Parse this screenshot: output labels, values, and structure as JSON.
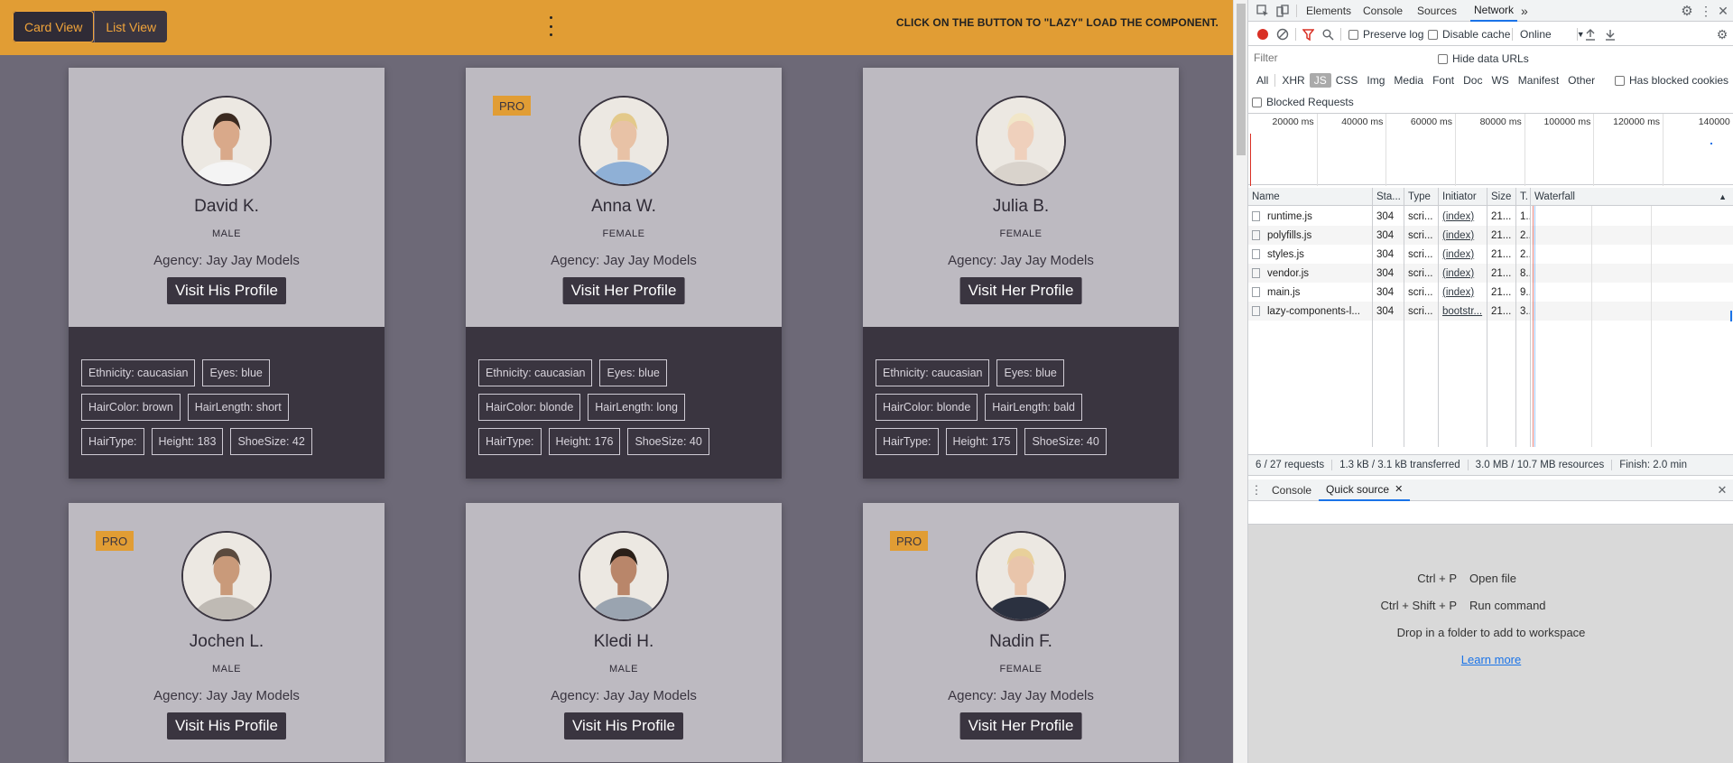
{
  "app": {
    "view_toggle": [
      {
        "label": "Card View",
        "active": true
      },
      {
        "label": "List View",
        "active": false
      }
    ],
    "topbar_message": "CLICK ON THE BUTTON TO \"LAZY\" LOAD THE COMPONENT.",
    "colors": {
      "accent": "#e19d34",
      "dark": "#3a3540",
      "card": "#bdbac1",
      "background": "#6d6977"
    },
    "cards": [
      {
        "pro": false,
        "name": "David K.",
        "gender": "MALE",
        "agency": "Agency: Jay Jay Models",
        "button": "Visit His Profile",
        "tags": [
          [
            "Ethnicity: caucasian",
            "Eyes: blue"
          ],
          [
            "HairColor: brown",
            "HairLength: short"
          ],
          [
            "HairType:",
            "Height: 183",
            "ShoeSize: 42"
          ]
        ]
      },
      {
        "pro": true,
        "name": "Anna W.",
        "gender": "FEMALE",
        "agency": "Agency: Jay Jay Models",
        "button": "Visit Her Profile",
        "tags": [
          [
            "Ethnicity: caucasian",
            "Eyes: blue"
          ],
          [
            "HairColor: blonde",
            "HairLength: long"
          ],
          [
            "HairType:",
            "Height: 176",
            "ShoeSize: 40"
          ]
        ]
      },
      {
        "pro": false,
        "name": "Julia B.",
        "gender": "FEMALE",
        "agency": "Agency: Jay Jay Models",
        "button": "Visit Her Profile",
        "tags": [
          [
            "Ethnicity: caucasian",
            "Eyes: blue"
          ],
          [
            "HairColor: blonde",
            "HairLength: bald"
          ],
          [
            "HairType:",
            "Height: 175",
            "ShoeSize: 40"
          ]
        ]
      },
      {
        "pro": true,
        "name": "Jochen L.",
        "gender": "MALE",
        "agency": "Agency: Jay Jay Models",
        "button": "Visit His Profile",
        "tags": []
      },
      {
        "pro": false,
        "name": "Kledi H.",
        "gender": "MALE",
        "agency": "Agency: Jay Jay Models",
        "button": "Visit His Profile",
        "tags": []
      },
      {
        "pro": true,
        "name": "Nadin F.",
        "gender": "FEMALE",
        "agency": "Agency: Jay Jay Models",
        "button": "Visit Her Profile",
        "tags": []
      }
    ],
    "pro_label": "PRO"
  },
  "devtools": {
    "tabs": [
      "Elements",
      "Console",
      "Sources",
      "Network"
    ],
    "active_tab": "Network",
    "more_tabs": "»",
    "toolbar": {
      "preserve_log": "Preserve log",
      "disable_cache": "Disable cache",
      "throttle": "Online"
    },
    "filter": {
      "placeholder": "Filter",
      "hide_data_urls": "Hide data URLs"
    },
    "type_filters": [
      "All",
      "XHR",
      "JS",
      "CSS",
      "Img",
      "Media",
      "Font",
      "Doc",
      "WS",
      "Manifest",
      "Other"
    ],
    "active_type": "JS",
    "has_blocked_cookies": "Has blocked cookies",
    "blocked_requests": "Blocked Requests",
    "overview_ticks": [
      "20000 ms",
      "40000 ms",
      "60000 ms",
      "80000 ms",
      "100000 ms",
      "120000 ms",
      "140000"
    ],
    "columns": [
      "Name",
      "Sta...",
      "Type",
      "Initiator",
      "Size",
      "T.",
      "Waterfall"
    ],
    "rows": [
      {
        "name": "runtime.js",
        "status": "304",
        "type": "scri...",
        "initiator": "(index)",
        "size": "21...",
        "time": "1..."
      },
      {
        "name": "polyfills.js",
        "status": "304",
        "type": "scri...",
        "initiator": "(index)",
        "size": "21...",
        "time": "2..."
      },
      {
        "name": "styles.js",
        "status": "304",
        "type": "scri...",
        "initiator": "(index)",
        "size": "21...",
        "time": "2..."
      },
      {
        "name": "vendor.js",
        "status": "304",
        "type": "scri...",
        "initiator": "(index)",
        "size": "21...",
        "time": "8..."
      },
      {
        "name": "main.js",
        "status": "304",
        "type": "scri...",
        "initiator": "(index)",
        "size": "21...",
        "time": "9..."
      },
      {
        "name": "lazy-components-l...",
        "status": "304",
        "type": "scri...",
        "initiator": "bootstr...",
        "size": "21...",
        "time": "3..."
      }
    ],
    "status_bar": [
      "6 / 27 requests",
      "1.3 kB / 3.1 kB transferred",
      "3.0 MB / 10.7 MB resources",
      "Finish: 2.0 min"
    ],
    "drawer": {
      "tabs": [
        "Console",
        "Quick source"
      ],
      "active_tab": "Quick source",
      "shortcuts": [
        {
          "keys": "Ctrl + P",
          "action": "Open file"
        },
        {
          "keys": "Ctrl + Shift + P",
          "action": "Run command"
        }
      ],
      "drop_text": "Drop in a folder to add to workspace",
      "learn_more": "Learn more"
    }
  }
}
